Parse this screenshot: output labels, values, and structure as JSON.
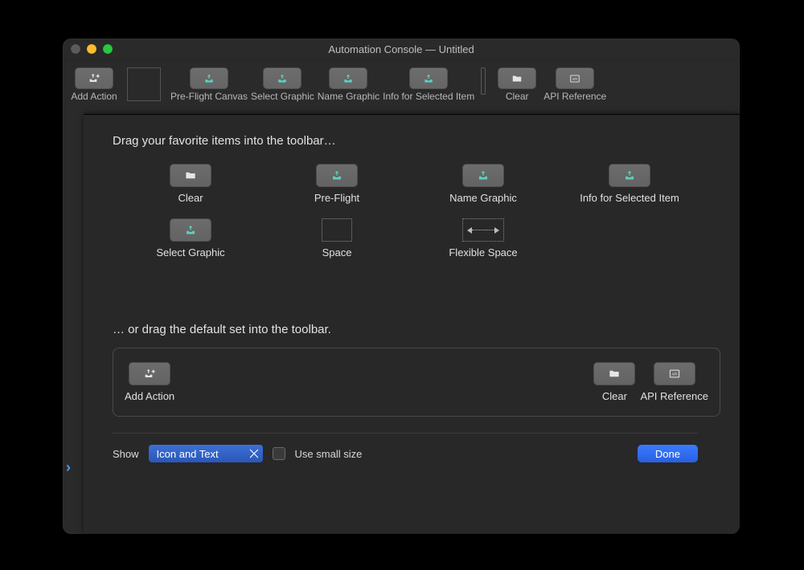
{
  "window": {
    "title": "Automation Console — Untitled"
  },
  "toolbar": {
    "items": [
      {
        "id": "add-action",
        "label": "Add Action"
      },
      {
        "id": "space",
        "label": ""
      },
      {
        "id": "preflight",
        "label": "Pre-Flight Canvas"
      },
      {
        "id": "select",
        "label": "Select Graphic"
      },
      {
        "id": "name",
        "label": "Name Graphic"
      },
      {
        "id": "info",
        "label": "Info for Selected Item"
      },
      {
        "id": "divider",
        "label": ""
      },
      {
        "id": "clear",
        "label": "Clear"
      },
      {
        "id": "api",
        "label": "API Reference"
      }
    ]
  },
  "sheet": {
    "heading1": "Drag your favorite items into the toolbar…",
    "heading2": "… or drag the default set into the toolbar."
  },
  "palette": {
    "row1": [
      {
        "id": "clear",
        "label": "Clear"
      },
      {
        "id": "preflight",
        "label": "Pre-Flight"
      },
      {
        "id": "name",
        "label": "Name Graphic"
      },
      {
        "id": "info",
        "label": "Info for Selected Item"
      }
    ],
    "row2": [
      {
        "id": "select",
        "label": "Select Graphic"
      },
      {
        "id": "space",
        "label": "Space"
      },
      {
        "id": "flexspace",
        "label": "Flexible Space"
      }
    ]
  },
  "defaultSet": {
    "items": [
      {
        "id": "add-action",
        "label": "Add Action"
      },
      {
        "id": "clear",
        "label": "Clear"
      },
      {
        "id": "api",
        "label": "API Reference"
      }
    ]
  },
  "footer": {
    "show_label": "Show",
    "popup_value": "Icon and Text",
    "small_size_label": "Use small size",
    "done_label": "Done"
  }
}
